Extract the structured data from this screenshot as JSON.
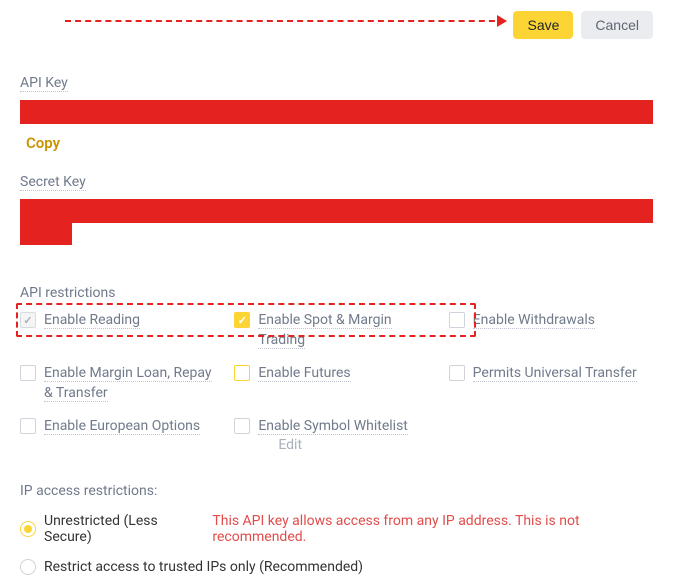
{
  "buttons": {
    "save": "Save",
    "cancel": "Cancel"
  },
  "apiKey": {
    "label": "API Key",
    "copy": "Copy"
  },
  "secretKey": {
    "label": "Secret Key"
  },
  "restrictions": {
    "title": "API restrictions",
    "items": {
      "reading": "Enable Reading",
      "spotMargin": "Enable Spot & Margin Trading",
      "withdrawals": "Enable Withdrawals",
      "marginLoan": "Enable Margin Loan, Repay & Transfer",
      "futures": "Enable Futures",
      "universalTransfer": "Permits Universal Transfer",
      "europeanOptions": "Enable European Options",
      "symbolWhitelist": "Enable Symbol Whitelist",
      "edit": "Edit"
    }
  },
  "ipAccess": {
    "title": "IP access restrictions:",
    "unrestricted": "Unrestricted (Less Secure)",
    "warning": "This API key allows access from any IP address. This is not recommended.",
    "restricted": "Restrict access to trusted IPs only (Recommended)"
  }
}
